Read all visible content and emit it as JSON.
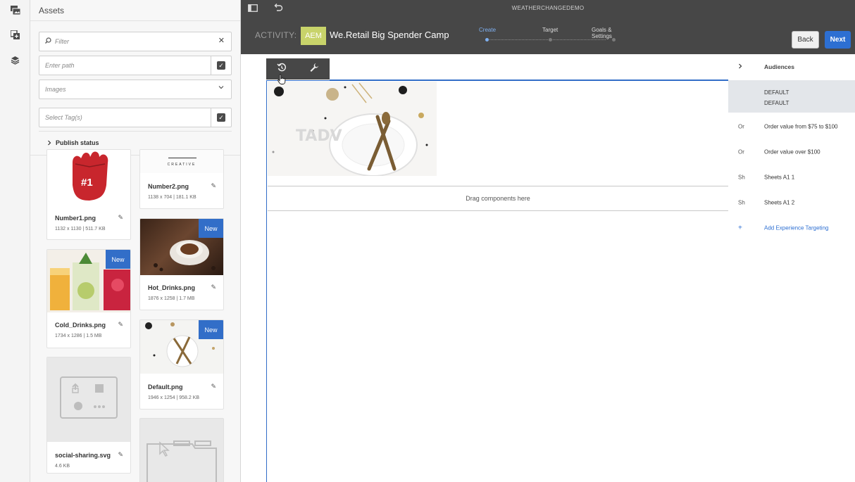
{
  "rail": {
    "icons": [
      "assets-icon",
      "components-icon",
      "layers-icon"
    ]
  },
  "assets_panel": {
    "title": "Assets",
    "filter_placeholder": "Filter",
    "path_placeholder": "Enter path",
    "type_select": "Images",
    "tags_placeholder": "Select Tag(s)",
    "publish_status": "Publish status",
    "badge_label": "New",
    "cards": [
      {
        "name": "Number2.png",
        "meta": "1138 x 704 | 181.1 KB",
        "new": false,
        "thumb_text": "CREATIVE"
      },
      {
        "name": "Number1.png",
        "meta": "1132 x 1130 | 511.7 KB",
        "new": false,
        "thumb_text": "#1"
      },
      {
        "name": "Hot_Drinks.png",
        "meta": "1876 x 1258 | 1.7 MB",
        "new": true
      },
      {
        "name": "Cold_Drinks.png",
        "meta": "1734 x 1286 | 1.5 MB",
        "new": true
      },
      {
        "name": "Default.png",
        "meta": "1946 x 1254 | 958.2 KB",
        "new": true
      },
      {
        "name": "social-sharing.svg",
        "meta": "4.6 KB",
        "new": false
      }
    ]
  },
  "header": {
    "doc_title": "WEATHERCHANGEDEMO",
    "activity_label": "ACTIVITY:",
    "brand_badge": "AEM",
    "campaign_name": "We.Retail Big Spender Camp",
    "steps": [
      "Create",
      "Target",
      "Goals & Settings"
    ],
    "active_step": 0,
    "back_label": "Back",
    "next_label": "Next"
  },
  "canvas": {
    "drop_zone_text": "Drag components here"
  },
  "audiences": {
    "title": "Audiences",
    "default_label": "DEFAULT",
    "default_sublabel": "DEFAULT",
    "items": [
      {
        "prefix": "Or",
        "label": "Order value from $75 to $100"
      },
      {
        "prefix": "Or",
        "label": "Order value over $100"
      },
      {
        "prefix": "Sh",
        "label": "Sheets A1 1"
      },
      {
        "prefix": "Sh",
        "label": "Sheets A1 2"
      }
    ],
    "add_label": "Add Experience Targeting",
    "add_symbol": "+"
  },
  "colors": {
    "accent": "#326ec8",
    "topbar": "#474747",
    "brand_badge": "#c8d36a",
    "badge_new": "#326ec8"
  }
}
